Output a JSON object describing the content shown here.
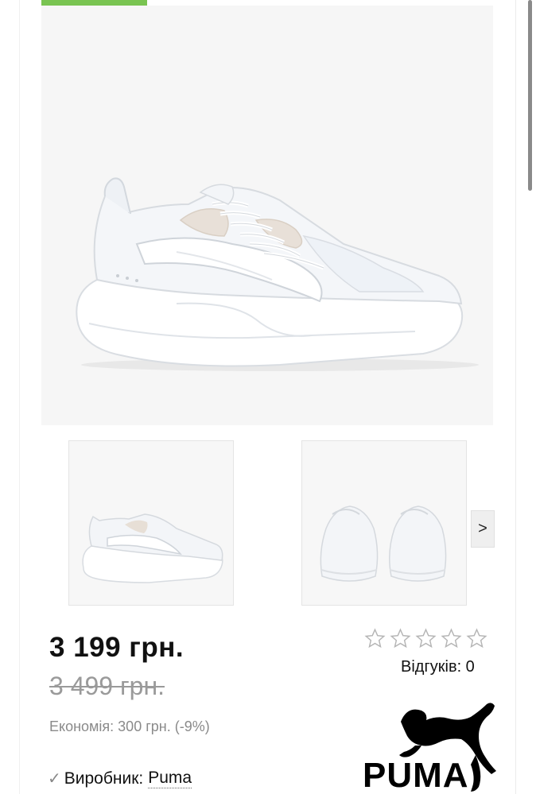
{
  "product": {
    "price": "3 199 грн.",
    "old_price": "3 499 грн.",
    "savings": "Економія: 300 грн. (-9%)",
    "maker_label": "Виробник:",
    "maker_name": "Puma"
  },
  "gallery": {
    "main_image": "white-sneaker-side-view",
    "thumbnails": [
      "white-sneaker-side-view",
      "white-sneakers-back-view"
    ],
    "next_label": ">"
  },
  "rating": {
    "stars_total": 5,
    "stars_filled": 0,
    "reviews_label": "Відгуків: 0"
  },
  "brand_logo": {
    "text": "PUMA"
  },
  "colors": {
    "accent_green": "#79c451",
    "old_price": "#9a9a9a",
    "star_outline": "#b5b5b5"
  }
}
